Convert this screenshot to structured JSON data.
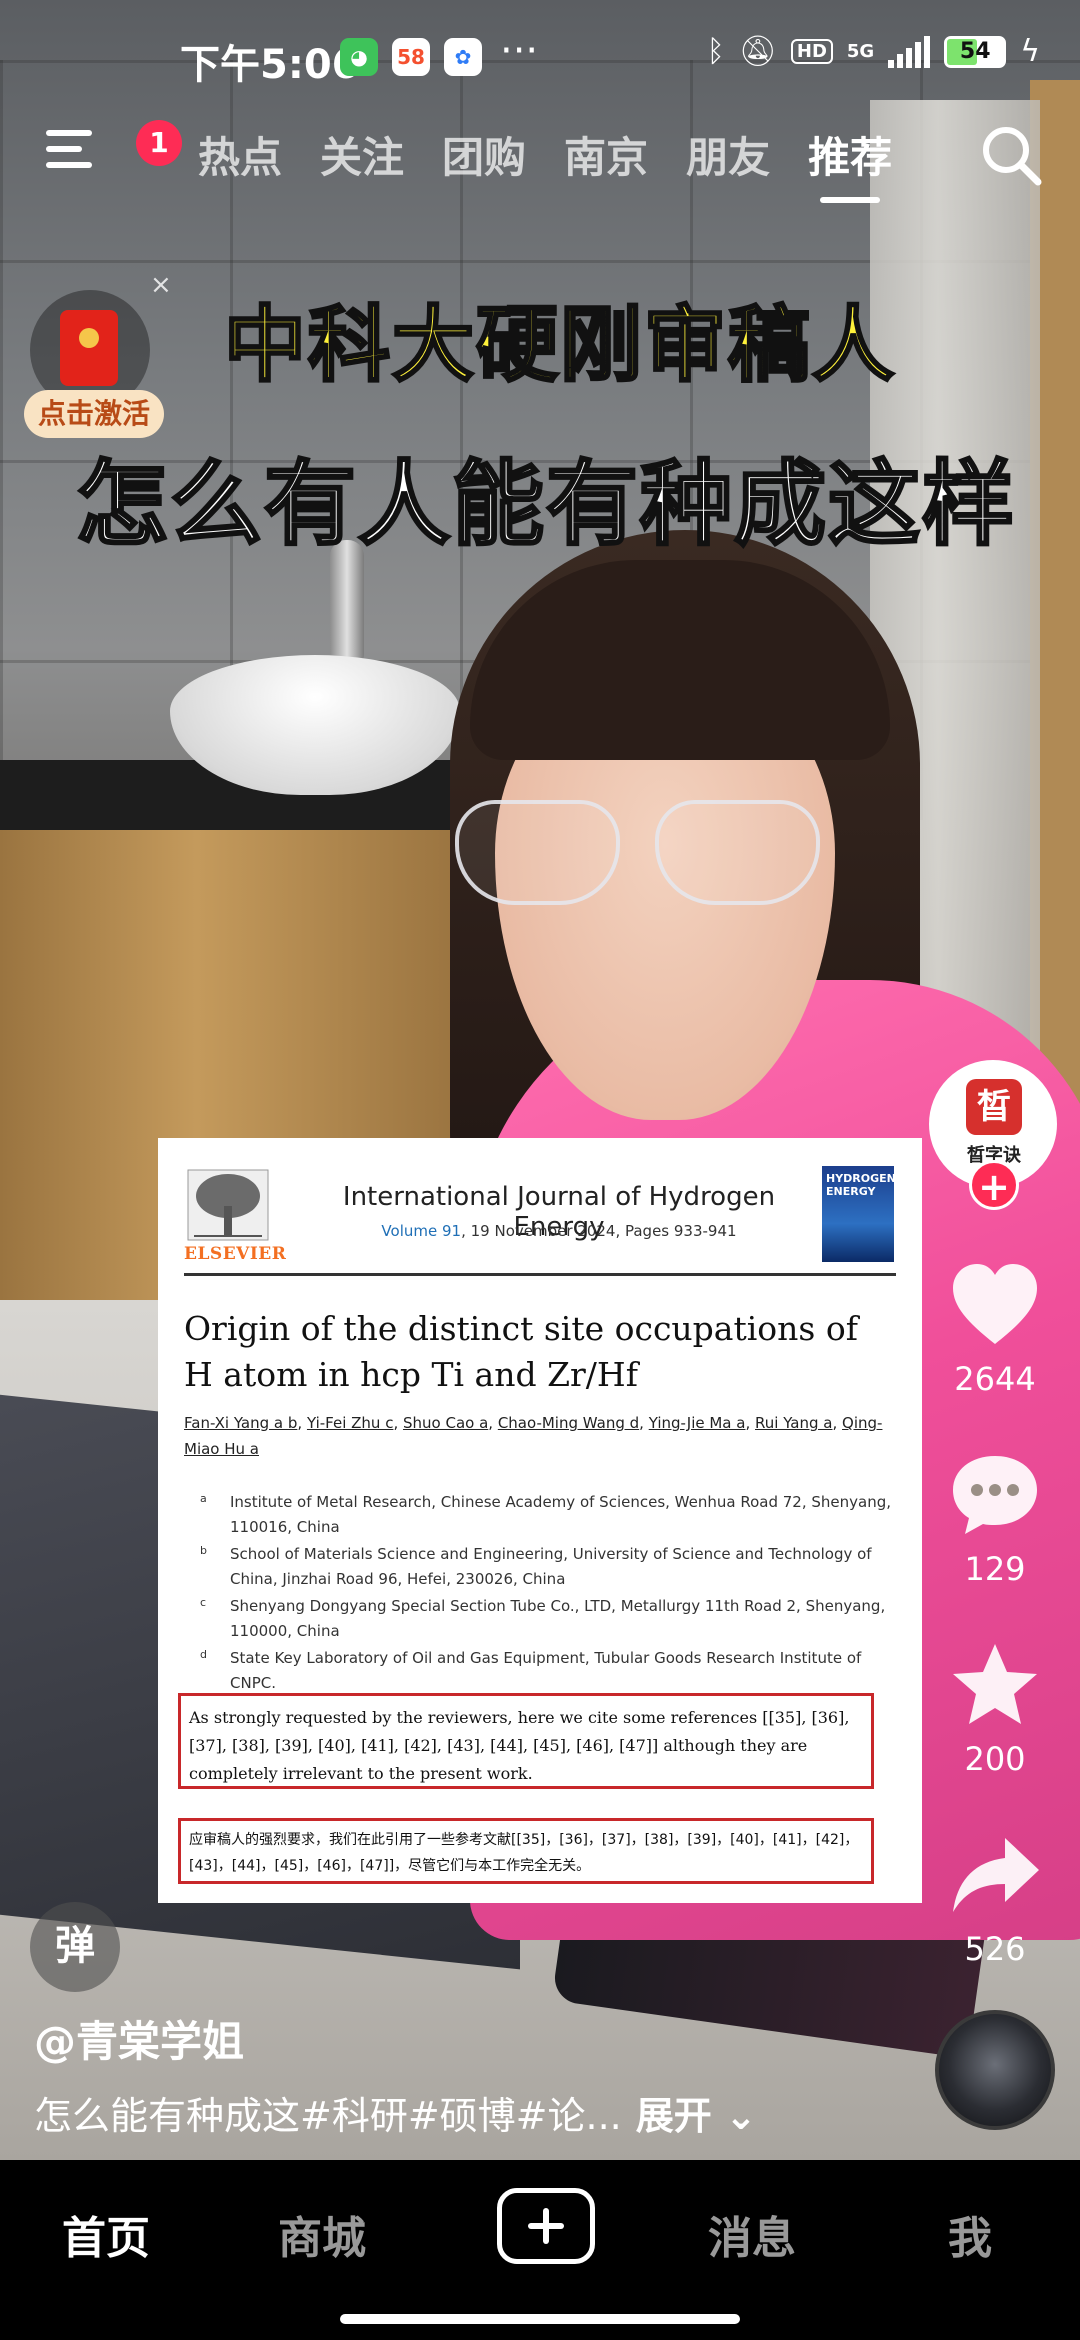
{
  "status_bar": {
    "time": "下午5:06",
    "app_badge_58": "58",
    "dots": "···",
    "network": "5G",
    "hd": "HD",
    "battery": "54"
  },
  "top_nav": {
    "notification_count": "1",
    "tabs": [
      "热点",
      "关注",
      "团购",
      "南京",
      "朋友",
      "推荐"
    ],
    "active_tab": "推荐"
  },
  "overlay": {
    "caption_line1": "中科大硬刚审稿人",
    "caption_line2": "怎么有人能有种成这样",
    "activate_label": "点击激活",
    "close_symbol": "×"
  },
  "paper": {
    "publisher": "ELSEVIER",
    "journal": "International Journal of Hydrogen Energy",
    "volume": "Volume 91",
    "issue_info": ", 19 November 2024, Pages 933-941",
    "cover_text": "HYDROGEN ENERGY",
    "title": "Origin of the distinct site occupations of H atom in hcp Ti and Zr/Hf",
    "authors": [
      "Fan-Xi Yang a b",
      "Yi-Fei Zhu c",
      "Shuo Cao a",
      "Chao-Ming Wang d",
      "Ying-Jie Ma a",
      "Rui Yang a",
      "Qing-Miao Hu a"
    ],
    "affiliations": [
      {
        "mark": "a",
        "text": "Institute of Metal Research, Chinese Academy of Sciences, Wenhua Road 72, Shenyang, 110016, China"
      },
      {
        "mark": "b",
        "text": "School of Materials Science and Engineering, University of Science and Technology of China, Jinzhai Road 96, Hefei, 230026, China"
      },
      {
        "mark": "c",
        "text": "Shenyang Dongyang Special Section Tube Co., LTD, Metallurgy 11th Road 2, Shenyang, 110000, China"
      },
      {
        "mark": "d",
        "text": "State Key Laboratory of Oil and Gas Equipment, Tubular Goods Research Institute of CNPC."
      }
    ],
    "highlight_en": "As strongly requested by the reviewers, here we cite some references [[35], [36], [37], [38], [39], [40], [41], [42], [43], [44], [45], [46], [47]] although they are completely irrelevant to the present work.",
    "highlight_cn": "应审稿人的强烈要求，我们在此引用了一些参考文献[[35]，[36]，[37]，[38]，[39]，[40]，[41]，[42]，[43]，[44]，[45]，[46]，[47]]，尽管它们与本工作完全无关。"
  },
  "rail": {
    "account_name": "晳字诀",
    "account_seal": "晳",
    "follow": "+",
    "likes": "2644",
    "comments": "129",
    "favorites": "200",
    "shares": "526"
  },
  "video_info": {
    "danmu_label": "弹",
    "author": "@青棠学姐",
    "description": "怎么能有种成这#科研#硕博#论...",
    "expand": "展开"
  },
  "tab_bar": {
    "tabs": [
      "首页",
      "商城",
      "消息",
      "我"
    ],
    "active": "首页"
  },
  "colors": {
    "accent": "#fe2c55",
    "caption_yellow": "#fff23a",
    "highlight_border": "#c8282a"
  }
}
